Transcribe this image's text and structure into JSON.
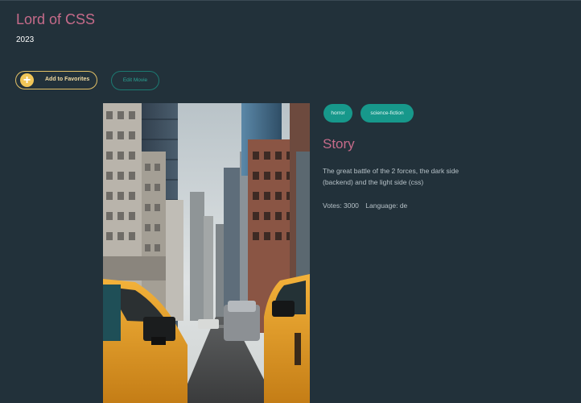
{
  "movie": {
    "title": "Lord of CSS",
    "year": "2023",
    "tags": [
      "horror",
      "science-fiction"
    ],
    "story_heading": "Story",
    "description": "The great battle of the 2 forces, the dark side (backend) and the light side (css)",
    "votes_label": "Votes: 3000",
    "language_label": "Language: de"
  },
  "actions": {
    "add_favorites_icon": "plus-icon",
    "add_favorites_label": "Add to Favorites",
    "edit_label": "Edit Movie"
  },
  "colors": {
    "background": "#22313a",
    "accent_pink": "#c66b8a",
    "tag_teal": "#17988b",
    "favorite_yellow": "#f1c658"
  },
  "poster": {
    "description": "city street with skyscrapers and yellow taxi cabs"
  }
}
